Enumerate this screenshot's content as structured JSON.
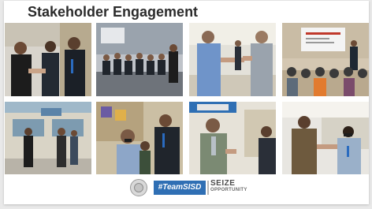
{
  "header": {
    "title": "Stakeholder Engagement"
  },
  "photos": [
    {
      "name": "photo-handshake-officials"
    },
    {
      "name": "photo-auditorium-seated-group"
    },
    {
      "name": "photo-handshake-school-hallway"
    },
    {
      "name": "photo-presentation-audience"
    },
    {
      "name": "photo-building-exterior-visitors"
    },
    {
      "name": "photo-students-greeting-officials"
    },
    {
      "name": "photo-officials-in-hallway"
    },
    {
      "name": "photo-handshake-staff-member"
    }
  ],
  "footer": {
    "hashtag": "#TeamSISD",
    "slogan_line1": "SEIZE",
    "slogan_line2": "OPPORTUNITY"
  },
  "colors": {
    "accent_blue": "#2f6fb4",
    "title_text": "#2b2b2b"
  }
}
